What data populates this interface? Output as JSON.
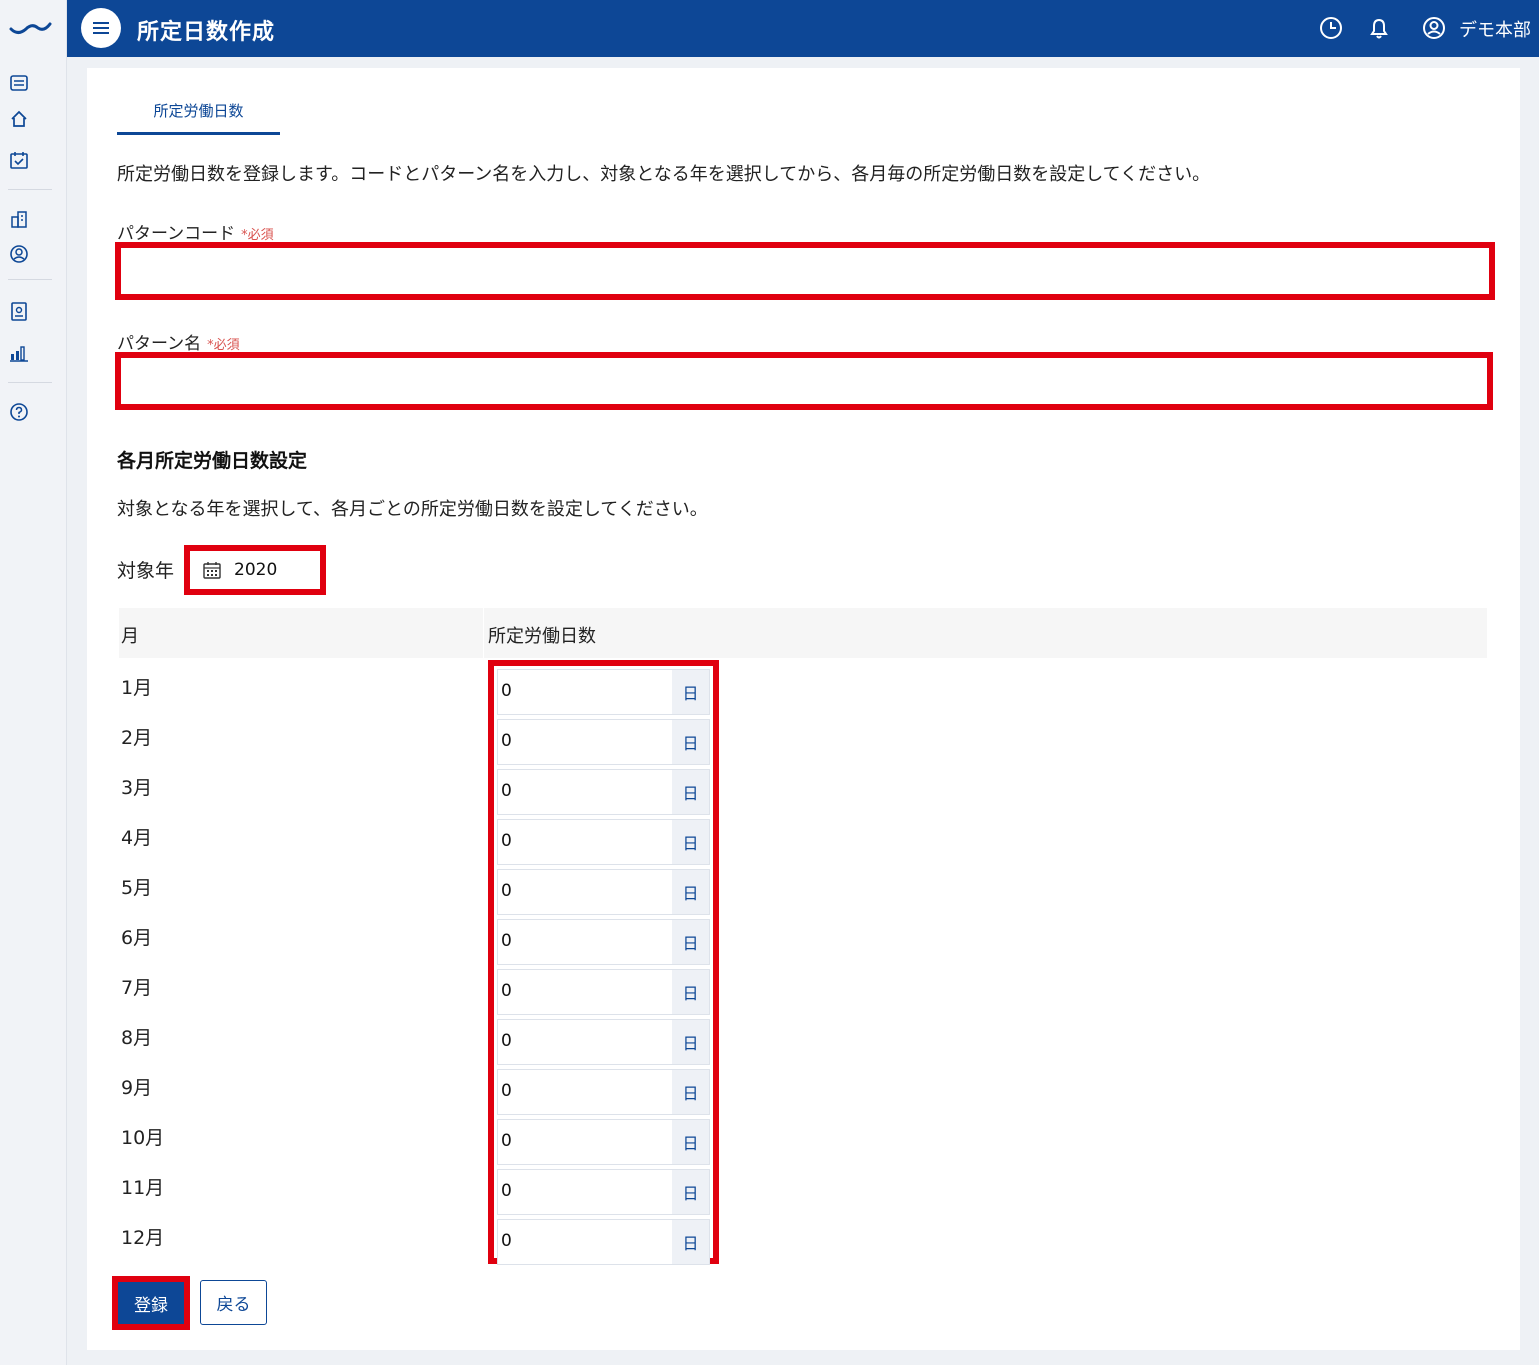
{
  "header": {
    "title": "所定日数作成",
    "user_name": "デモ本部"
  },
  "rail": {
    "icons": [
      "logo-icon",
      "list-icon",
      "home-icon",
      "calendar-check-icon",
      "building-icon",
      "user-circle-icon",
      "id-badge-icon",
      "bar-chart-icon",
      "help-icon"
    ]
  },
  "tabs": [
    {
      "label": "所定労働日数"
    }
  ],
  "description": "所定労働日数を登録します。コードとパターン名を入力し、対象となる年を選択してから、各月毎の所定労働日数を設定してください。",
  "fields": {
    "pattern_code": {
      "label": "パターンコード",
      "required": "*必須",
      "value": ""
    },
    "pattern_name": {
      "label": "パターン名",
      "required": "*必須",
      "value": ""
    }
  },
  "monthly": {
    "title": "各月所定労働日数設定",
    "description": "対象となる年を選択して、各月ごとの所定労働日数を設定してください。",
    "year_label": "対象年",
    "year": "2020",
    "columns": [
      "月",
      "所定労働日数"
    ],
    "unit": "日",
    "rows": [
      {
        "month": "1月",
        "days": "0"
      },
      {
        "month": "2月",
        "days": "0"
      },
      {
        "month": "3月",
        "days": "0"
      },
      {
        "month": "4月",
        "days": "0"
      },
      {
        "month": "5月",
        "days": "0"
      },
      {
        "month": "6月",
        "days": "0"
      },
      {
        "month": "7月",
        "days": "0"
      },
      {
        "month": "8月",
        "days": "0"
      },
      {
        "month": "9月",
        "days": "0"
      },
      {
        "month": "10月",
        "days": "0"
      },
      {
        "month": "11月",
        "days": "0"
      },
      {
        "month": "12月",
        "days": "0"
      }
    ]
  },
  "actions": {
    "register": "登録",
    "back": "戻る"
  },
  "colors": {
    "primary": "#0d4796",
    "highlight": "#e0000f",
    "required": "#d9534f"
  }
}
